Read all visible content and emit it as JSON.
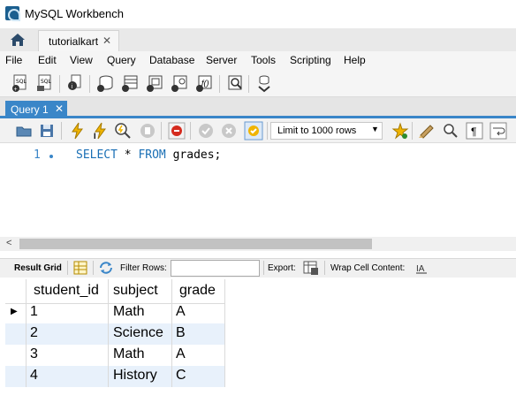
{
  "window": {
    "title": "MySQL Workbench"
  },
  "tabs": {
    "home_icon": "house-icon",
    "active_tab": "tutorialkart",
    "close_glyph": "✕"
  },
  "menu": [
    "File",
    "Edit",
    "View",
    "Query",
    "Database",
    "Server",
    "Tools",
    "Scripting",
    "Help"
  ],
  "query_tab": {
    "label": "Query 1",
    "close_glyph": "✕"
  },
  "sql_toolbar": {
    "limit_label": "Limit to 1000 rows"
  },
  "editor": {
    "line_number": "1",
    "keyword_select": "SELECT",
    "star": " * ",
    "keyword_from": "FROM",
    "rest": " grades;"
  },
  "result_toolbar": {
    "result_grid": "Result Grid",
    "filter_rows": "Filter Rows:",
    "export": "Export:",
    "wrap_cell": "Wrap Cell Content:",
    "filter_value": ""
  },
  "grid": {
    "columns": [
      "student_id",
      "subject",
      "grade"
    ],
    "rows": [
      [
        "1",
        "Math",
        "A"
      ],
      [
        "2",
        "Science",
        "B"
      ],
      [
        "3",
        "Math",
        "A"
      ],
      [
        "4",
        "History",
        "C"
      ]
    ]
  },
  "colors": {
    "accent": "#3a86c8",
    "keyword": "#1a6fb5",
    "alt_row": "#e8f1fb"
  }
}
